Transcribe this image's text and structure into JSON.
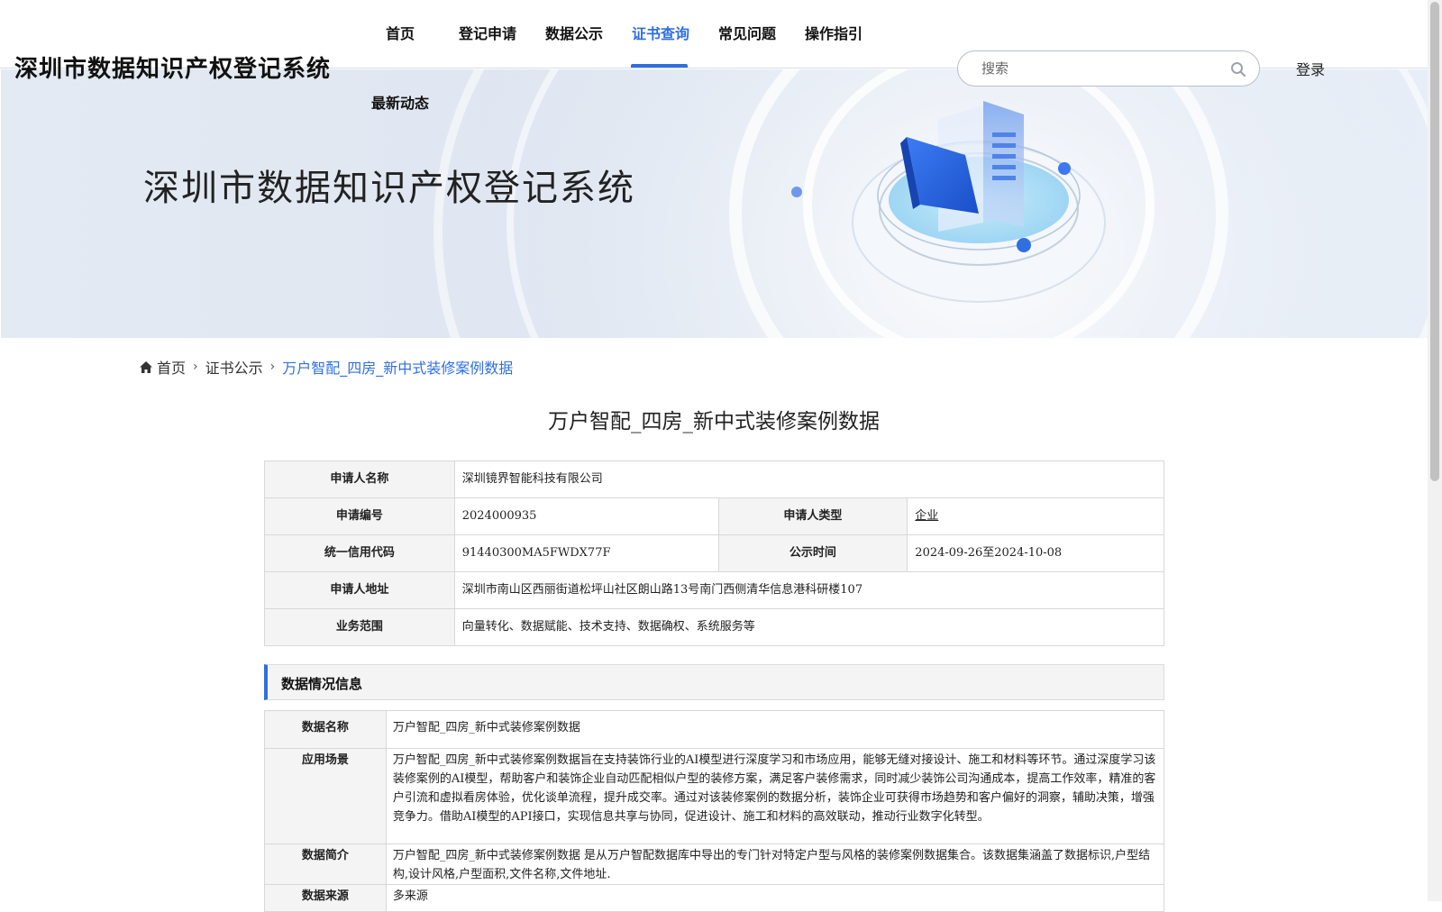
{
  "header": {
    "site_title": "深圳市数据知识产权登记系统",
    "nav": [
      {
        "label": "首页",
        "active": false
      },
      {
        "label": "登记申请",
        "active": false
      },
      {
        "label": "数据公示",
        "active": false
      },
      {
        "label": "证书查询",
        "active": true
      },
      {
        "label": "常见问题",
        "active": false
      },
      {
        "label": "操作指引",
        "active": false
      },
      {
        "label": "最新动态",
        "active": false
      }
    ],
    "search_placeholder": "搜索",
    "login_label": "登录"
  },
  "banner": {
    "title": "深圳市数据知识产权登记系统"
  },
  "breadcrumb": {
    "home": "首页",
    "section": "证书公示",
    "current": "万户智配_四房_新中式装修案例数据"
  },
  "page_title": "万户智配_四房_新中式装修案例数据",
  "applicant": {
    "name_label": "申请人名称",
    "name_value": "深圳镜界智能科技有限公司",
    "number_label": "申请编号",
    "number_value": "2024000935",
    "type_label": "申请人类型",
    "type_value": "企业",
    "credit_label": "统一信用代码",
    "credit_value": "91440300MA5FWDX77F",
    "publicity_label": "公示时间",
    "publicity_value": "2024-09-26至2024-10-08",
    "address_label": "申请人地址",
    "address_value": "深圳市南山区西丽街道松坪山社区朗山路13号南门西侧清华信息港科研楼107",
    "scope_label": "业务范围",
    "scope_value": "向量转化、数据赋能、技术支持、数据确权、系统服务等"
  },
  "data_section": {
    "heading": "数据情况信息",
    "name_label": "数据名称",
    "name_value": "万户智配_四房_新中式装修案例数据",
    "scenario_label": "应用场景",
    "scenario_value": "万户智配_四房_新中式装修案例数据旨在支持装饰行业的AI模型进行深度学习和市场应用，能够无缝对接设计、施工和材料等环节。通过深度学习该装修案例的AI模型，帮助客户和装饰企业自动匹配相似户型的装修方案，满足客户装修需求，同时减少装饰公司沟通成本，提高工作效率，精准的客户引流和虚拟看房体验，优化谈单流程，提升成交率。通过对该装修案例的数据分析，装饰企业可获得市场趋势和客户偏好的洞察，辅助决策，增强竞争力。借助AI模型的API接口，实现信息共享与协同，促进设计、施工和材料的高效联动，推动行业数字化转型。",
    "intro_label": "数据简介",
    "intro_value": "万户智配_四房_新中式装修案例数据 是从万户智配数据库中导出的专门针对特定户型与风格的装修案例数据集合。该数据集涵盖了数据标识,户型结构,设计风格,户型面积,文件名称,文件地址.",
    "source_label": "数据来源",
    "source_value": "多来源"
  },
  "colors": {
    "accent": "#2f6fe0",
    "label_bg": "#f4f4f4",
    "border": "#d8d8d8"
  }
}
